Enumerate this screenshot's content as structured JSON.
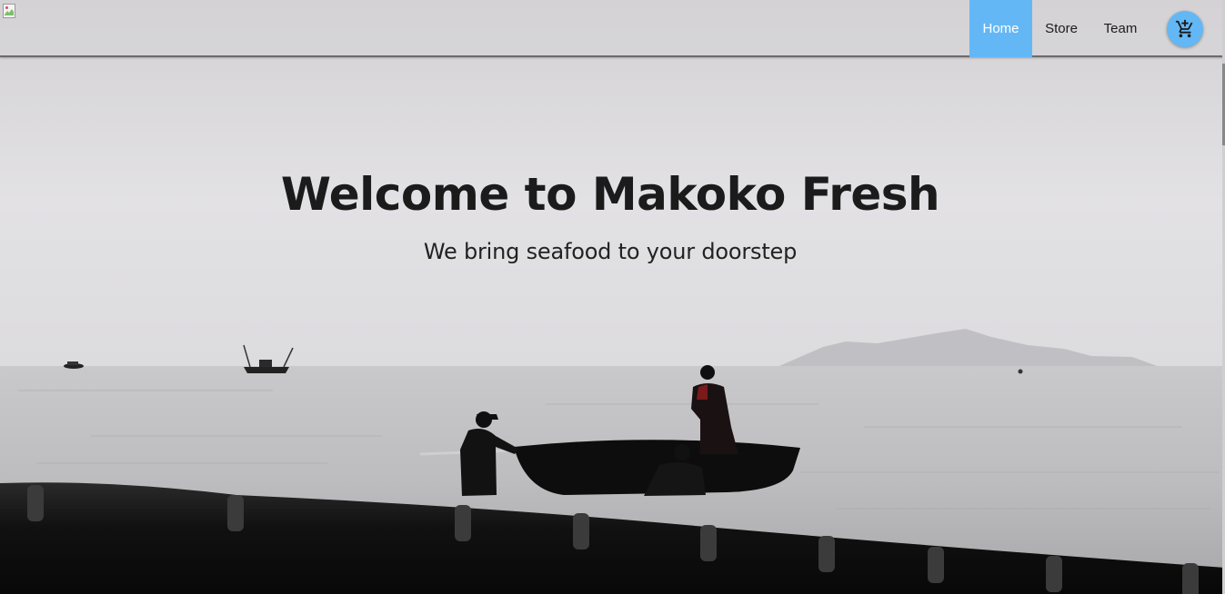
{
  "nav": {
    "items": [
      {
        "label": "Home"
      },
      {
        "label": "Store"
      },
      {
        "label": "Team"
      }
    ],
    "cart_icon": "add-shopping-cart-icon",
    "logo_icon": "broken-image-icon"
  },
  "hero": {
    "title": "Welcome to Makoko Fresh",
    "subtitle": "We bring seafood to your doorstep",
    "background_image": "fishermen-boat-sea-photo"
  },
  "colors": {
    "accent": "#64b7f5",
    "text": "#1b1b1b"
  }
}
